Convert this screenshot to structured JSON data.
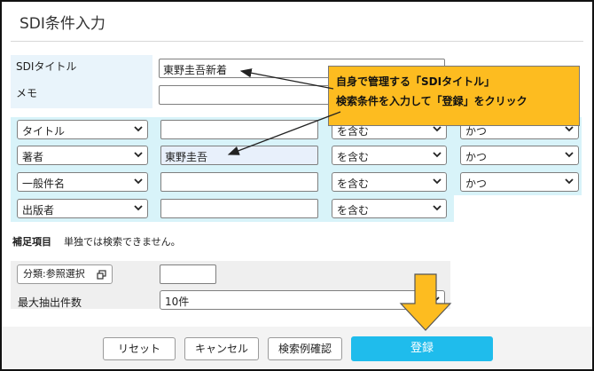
{
  "page": {
    "title": "SDI条件入力"
  },
  "sdi": {
    "title_label": "SDIタイトル",
    "title_value": "東野圭吾新着",
    "memo_label": "メモ"
  },
  "rows": [
    {
      "field": "タイトル",
      "value": "",
      "match": "を含む",
      "logic": "かつ"
    },
    {
      "field": "著者",
      "value": "東野圭吾",
      "match": "を含む",
      "logic": "かつ"
    },
    {
      "field": "一般件名",
      "value": "",
      "match": "を含む",
      "logic": "かつ"
    },
    {
      "field": "出版者",
      "value": "",
      "match": "を含む"
    }
  ],
  "note": {
    "heading": "補足項目",
    "text": "単独では検索できません。"
  },
  "classification": {
    "button_label": "分類:参照選択",
    "value": ""
  },
  "max_results": {
    "label": "最大抽出件数",
    "value": "10件"
  },
  "actions": {
    "reset": "リセット",
    "cancel": "キャンセル",
    "example": "検索例確認",
    "register": "登録"
  },
  "callout": {
    "line1": "自身で管理する「SDIタイトル」",
    "line2": "検索条件を入力して「登録」をクリック"
  },
  "colors": {
    "callout": "#fdbc20",
    "primary": "#1fbcec",
    "label_bg": "#e9f4fb",
    "cyan_bg": "#d8f3f9"
  }
}
